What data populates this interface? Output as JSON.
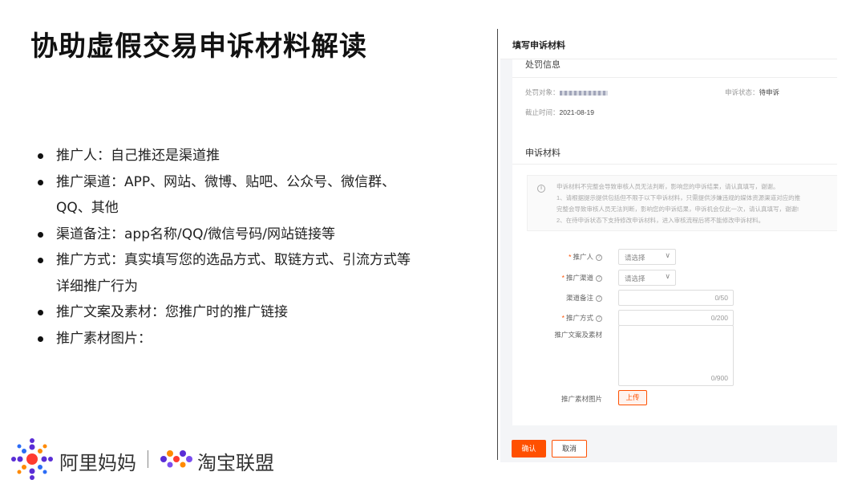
{
  "slide": {
    "title": "协助虚假交易申诉材料解读",
    "bullets": [
      "推广人：自己推还是渠道推",
      "推广渠道：APP、网站、微博、贴吧、公众号、微信群、",
      "QQ、其他",
      "渠道备注：app名称/QQ/微信号码/网站链接等",
      "推广方式：真实填写您的选品方式、取链方式、引流方式等",
      "详细推广行为",
      "推广文案及素材：您推广时的推广链接",
      "推广素材图片："
    ]
  },
  "logo": {
    "brand1": "阿里妈妈",
    "brand2": "淘宝联盟",
    "colors": {
      "purple": "#5a2dd6",
      "red": "#ff3b30",
      "orange": "#ff8a00",
      "blue": "#2b6cf6"
    }
  },
  "screenshot": {
    "header_title": "填写申诉材料",
    "penalty": {
      "title": "处罚信息",
      "target_label": "处罚对象：",
      "status_label": "申诉状态：",
      "status_value": "待申诉",
      "deadline_label": "截止时间：",
      "deadline_value": "2021-08-19"
    },
    "section_title": "申诉材料",
    "notice_lines": [
      "申诉材料不完整会导致审核人员无法判断，影响您的申诉结果，请认真填写，谢谢。",
      "1、请根据提示提供包括但不限于以下申诉材料，只需提供涉嫌违规的媒体资源渠道对应的推",
      "完整会导致审核人员无法判断，影响您的申诉结果，申诉机会仅此一次，请认真填写，谢谢!",
      "2、在待申诉状态下支持修改申诉材料，进入审核流程后将不能修改申诉材料。"
    ],
    "form": {
      "promoter_label": "推广人",
      "channel_label": "推广渠道",
      "channel_note_label": "渠道备注",
      "method_label": "推广方式",
      "copy_label": "推广文案及素材",
      "images_label": "推广素材图片",
      "select_placeholder": "请选择",
      "note_counter": "0/50",
      "method_counter": "0/200",
      "copy_counter": "0/900",
      "upload_label": "上传",
      "required_mark": "*",
      "help_mark": "?"
    },
    "confirm_label": "确认",
    "cancel_label": "取消",
    "accent_color": "#ff5000"
  }
}
